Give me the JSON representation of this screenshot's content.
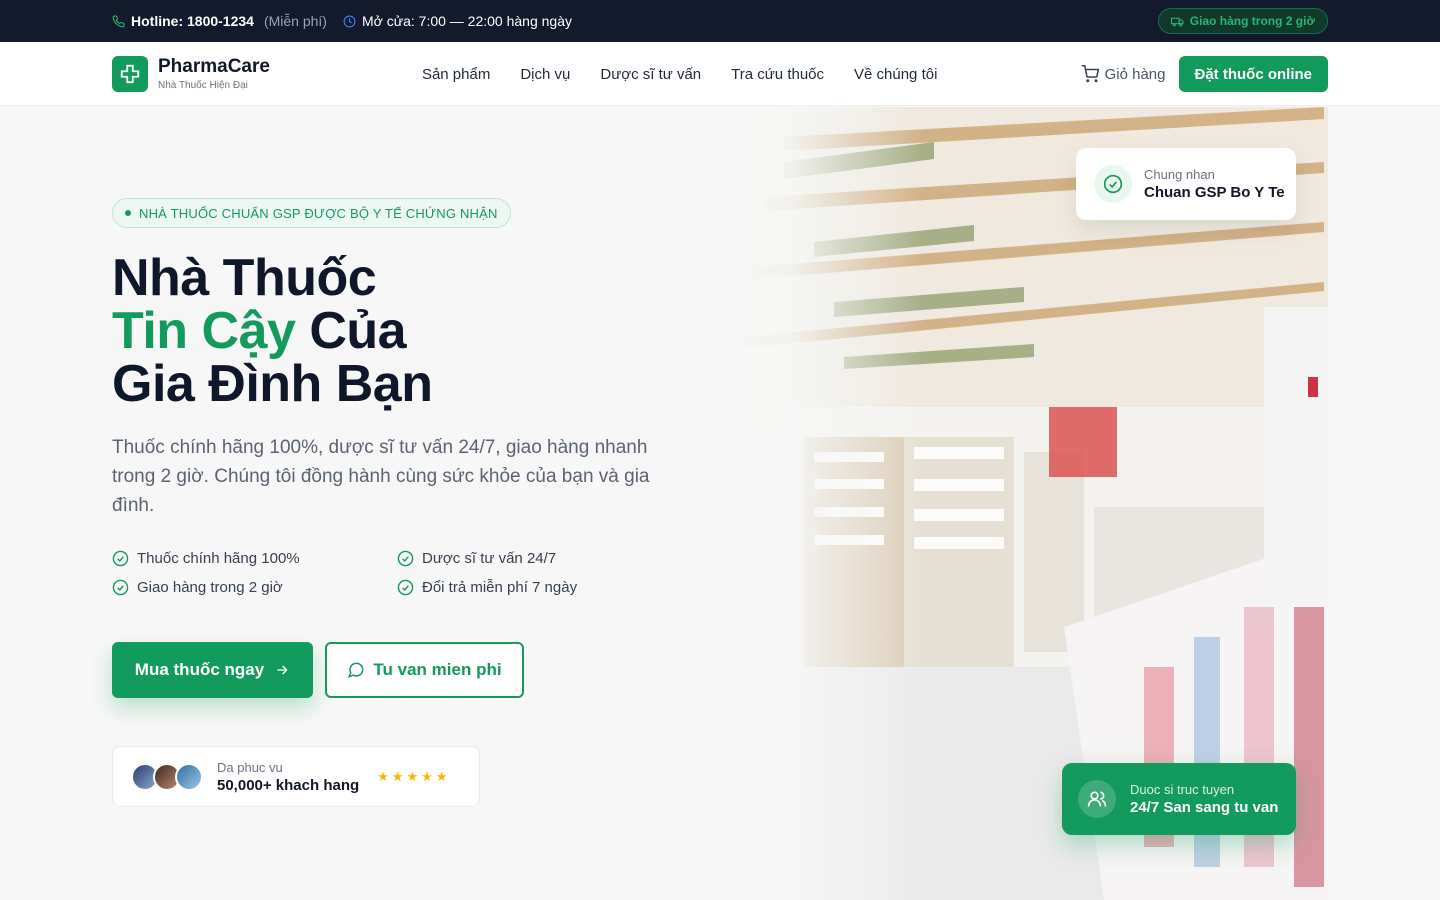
{
  "topbar": {
    "hotline": "Hotline: 1800-1234",
    "free": "(Miễn phí)",
    "hours": "Mở cửa: 7:00 — 22:00 hàng ngày",
    "delivery_pill": "Giao hàng trong 2 giờ"
  },
  "brand": {
    "name": "PharmaCare",
    "tagline": "Nhà Thuốc Hiện Đại"
  },
  "nav": {
    "items": [
      "Sản phẩm",
      "Dịch vụ",
      "Dược sĩ tư vấn",
      "Tra cứu thuốc",
      "Về chúng tôi"
    ],
    "cart_label": "Giỏ hàng",
    "cta_label": "Đặt thuốc online"
  },
  "hero": {
    "badge": "NHÀ THUỐC CHUẨN GSP ĐƯỢC BỘ Y TẾ CHỨNG NHẬN",
    "headline_line1": "Nhà Thuốc",
    "headline_green": "Tin Cậy",
    "headline_line2_rest": " Của",
    "headline_line3": "Gia Đình Bạn",
    "lead": "Thuốc chính hãng 100%, dược sĩ tư vấn 24/7, giao hàng nhanh trong 2 giờ. Chúng tôi đồng hành cùng sức khỏe của bạn và gia đình.",
    "features": [
      "Thuốc chính hãng 100%",
      "Dược sĩ tư vấn 24/7",
      "Giao hàng trong 2 giờ",
      "Đổi trả miễn phí 7 ngày"
    ],
    "buy_button": "Mua thuốc ngay",
    "consult_button": "Tu van mien phi",
    "customers_small": "Da phuc vu",
    "customers_big": "50,000+ khach hang",
    "stars": "★★★★★",
    "rating": 5
  },
  "cards": {
    "gsp_small": "Chung nhan",
    "gsp_big": "Chuan GSP Bo Y Te",
    "pharmacist_small": "Duoc si truc tuyen",
    "pharmacist_big": "24/7 San sang tu van"
  },
  "colors": {
    "brand_green": "#139a5d",
    "topbar_bg": "#141a2e",
    "star": "#f6b800"
  },
  "icons": {
    "phone": "phone-icon",
    "clock": "clock-icon",
    "truck": "truck-icon",
    "cross": "medical-cross-icon",
    "cart": "cart-icon",
    "check": "check-circle-icon",
    "arrow": "arrow-right-icon",
    "chat": "chat-bubble-icon",
    "users": "users-icon"
  }
}
